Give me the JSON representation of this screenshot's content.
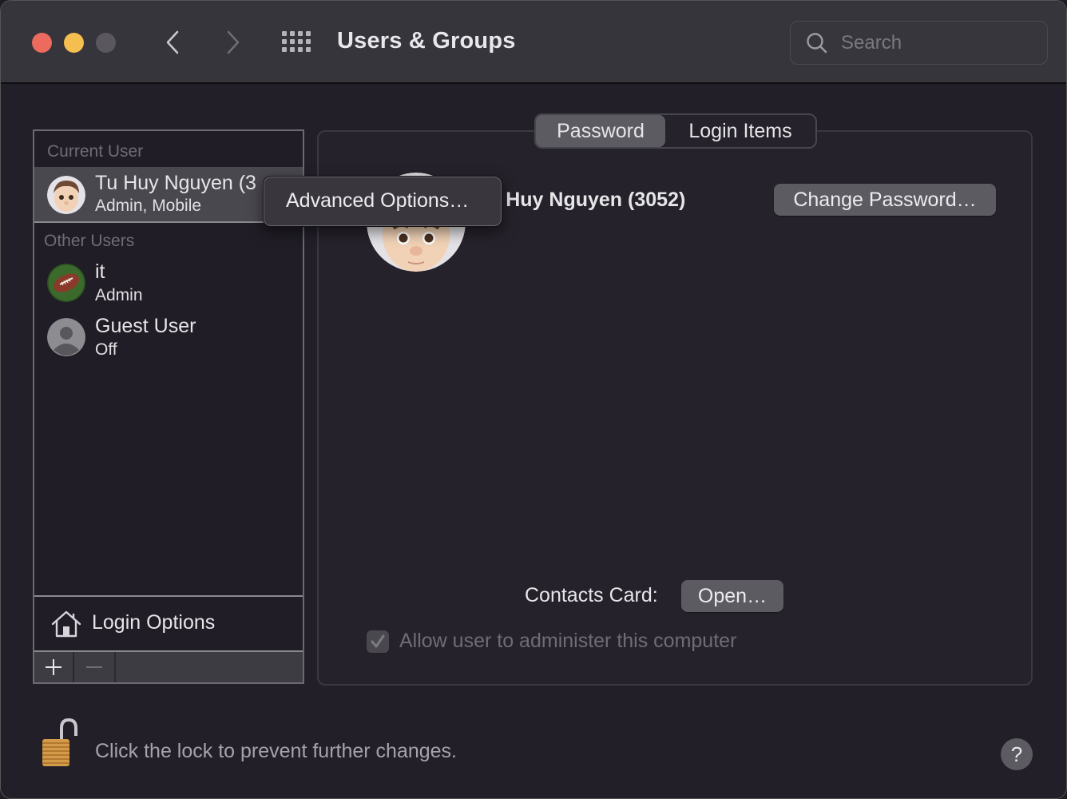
{
  "window": {
    "title": "Users & Groups",
    "search": {
      "placeholder": "Search",
      "value": ""
    }
  },
  "sidebar": {
    "current_user_label": "Current User",
    "other_users_label": "Other Users",
    "current_user": {
      "name": "Tu Huy Nguyen (3052)",
      "display_name": "Tu Huy Nguyen (3",
      "role": "Admin, Mobile",
      "avatar": "memoji-boy"
    },
    "other_users": [
      {
        "name": "it",
        "role": "Admin",
        "avatar": "football"
      },
      {
        "name": "Guest User",
        "role": "Off",
        "avatar": "generic-person"
      }
    ],
    "login_options_label": "Login Options",
    "add_label": "+",
    "remove_label": "−"
  },
  "tabs": [
    {
      "label": "Password",
      "active": true
    },
    {
      "label": "Login Items",
      "active": false
    }
  ],
  "details": {
    "full_name": "u Huy Nguyen (3052)",
    "change_password_label": "Change Password…",
    "contacts_card_label": "Contacts Card:",
    "open_label": "Open…",
    "admin_checkbox_label": "Allow user to administer this computer",
    "admin_checked": true,
    "admin_enabled": false
  },
  "context_menu": {
    "items": [
      {
        "label": "Advanced Options…"
      }
    ]
  },
  "footer": {
    "lock_state": "unlocked",
    "lock_text": "Click the lock to prevent further changes.",
    "help_label": "?"
  }
}
